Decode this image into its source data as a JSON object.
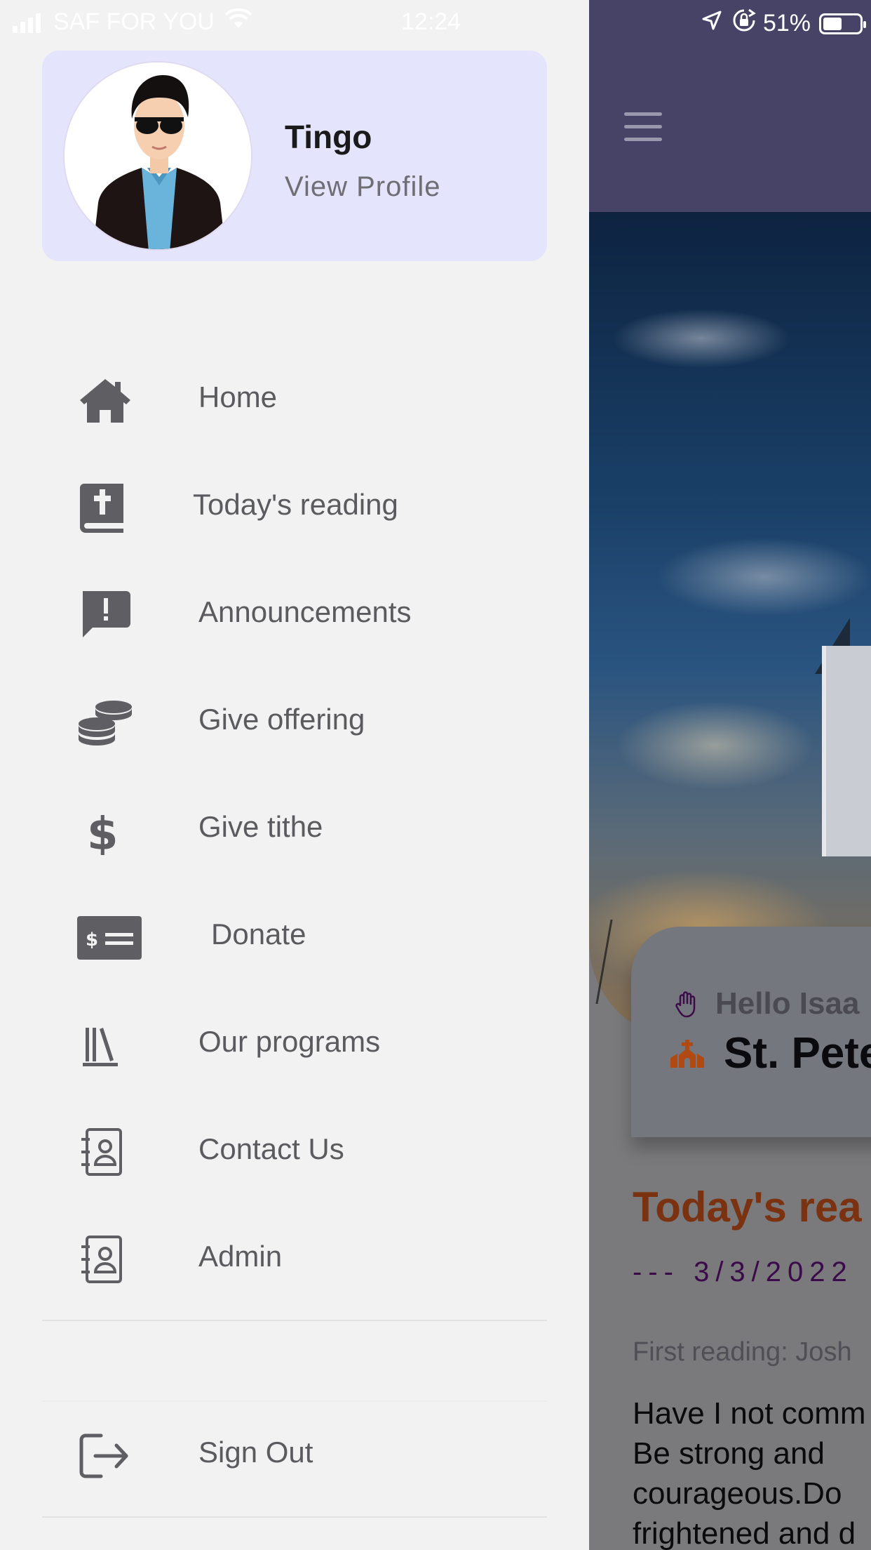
{
  "status_bar": {
    "carrier": "SAF FOR YOU",
    "time": "12:24",
    "battery": "51%"
  },
  "drawer": {
    "profile": {
      "name": "Tingo",
      "link": "View Profile"
    },
    "menu": [
      {
        "label": "Home",
        "icon": "home-icon"
      },
      {
        "label": "Today's reading",
        "icon": "bible-icon"
      },
      {
        "label": "Announcements",
        "icon": "announcement-icon"
      },
      {
        "label": "Give offering",
        "icon": "coins-icon"
      },
      {
        "label": "Give tithe",
        "icon": "dollar-icon"
      },
      {
        "label": "Donate",
        "icon": "money-check-icon"
      },
      {
        "label": "Our programs",
        "icon": "library-icon"
      },
      {
        "label": "Contact Us",
        "icon": "contact-book-icon"
      },
      {
        "label": "Admin",
        "icon": "contact-book-icon"
      }
    ],
    "sign_out": {
      "label": "Sign Out",
      "icon": "sign-out-icon"
    }
  },
  "main": {
    "greeting": "Hello Isaa",
    "church_name": "St. Pete",
    "reading_title": "Today's rea",
    "reading_date": "--- 3/3/2022",
    "first_reading": "First reading: Josh",
    "reading_body": [
      "Have I not comm",
      "Be strong and",
      "courageous.Do",
      "frightened and d"
    ]
  },
  "colors": {
    "header": "#474367",
    "profile_card": "#e4e4fc",
    "reading_title": "#7b3210",
    "reading_date": "#3b0a4a"
  }
}
